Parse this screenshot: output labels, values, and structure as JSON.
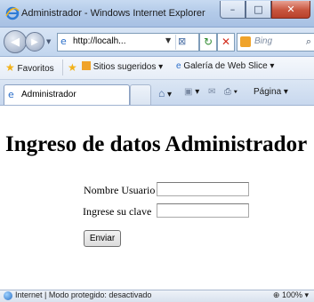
{
  "window": {
    "title": "Administrador - Windows Internet Explorer",
    "minimize_glyph": "–",
    "maximize_glyph": "□",
    "close_glyph": "✕"
  },
  "address_bar": {
    "url": "http://localh...",
    "search_placeholder": "Bing"
  },
  "favorites_bar": {
    "favorites_label": "Favoritos",
    "suggested_sites_label": "Sitios sugeridos ▾",
    "web_slice_label": "Galería de Web Slice ▾"
  },
  "tab": {
    "label": "Administrador"
  },
  "command_bar": {
    "page_label": "Página ▾"
  },
  "page": {
    "heading": "Ingreso de datos Administrador",
    "form": {
      "username_label": "Nombre Usuario",
      "username_value": "",
      "password_label": "Ingrese su clave",
      "password_value": "",
      "submit_label": "Enviar"
    }
  },
  "status_bar": {
    "text": "Internet | Modo protegido: desactivado",
    "zoom": "100%"
  }
}
